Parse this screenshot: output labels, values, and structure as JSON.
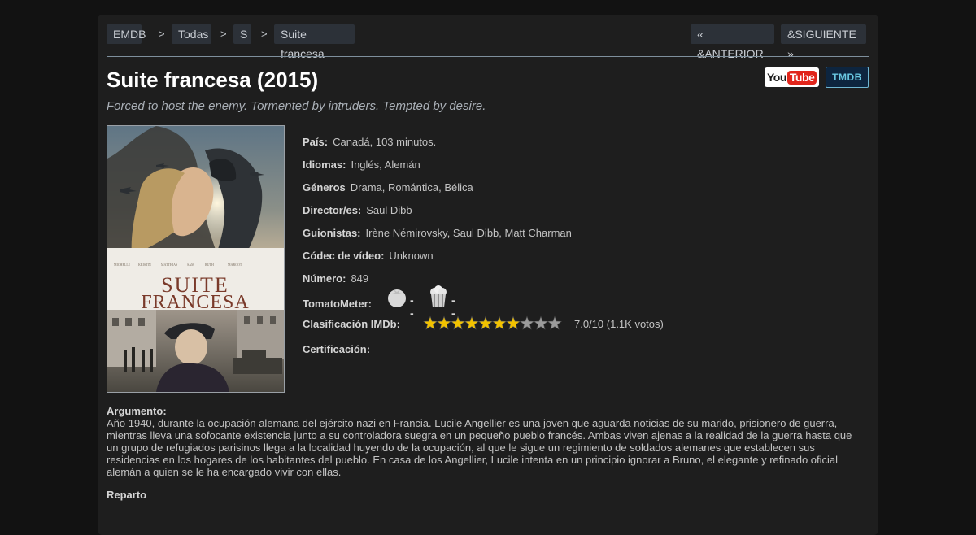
{
  "breadcrumb": {
    "items": [
      "EMDB",
      "Todas",
      "S",
      "Suite francesa"
    ],
    "separator": ">"
  },
  "nav": {
    "prev_label": "« &ANTERIOR",
    "next_label": "&SIGUIENTE »"
  },
  "logos": {
    "youtube_you": "You",
    "youtube_tube": "Tube",
    "tmdb": "TMDB"
  },
  "movie": {
    "title": "Suite francesa (2015)",
    "tagline": "Forced to host the enemy. Tormented by intruders. Tempted by desire.",
    "poster": {
      "title_line1": "SUITE",
      "title_line2": "FRANCESA"
    }
  },
  "details": {
    "pais_label": "País:",
    "pais_value": "Canadá, 103 minutos.",
    "idiomas_label": "Idiomas:",
    "idiomas_value": "Inglés, Alemán",
    "generos_label": "Géneros",
    "generos_value": "Drama, Romántica, Bélica",
    "director_label": "Director/es:",
    "director_value": "Saul Dibb",
    "guionistas_label": "Guionistas:",
    "guionistas_value": "Irène Némirovsky, Saul Dibb, Matt Charman",
    "codec_label": "Códec de vídeo:",
    "codec_value": "Unknown",
    "numero_label": "Número:",
    "numero_value": "849",
    "tomato_label": "TomatoMeter:",
    "tomato_critics": "--",
    "tomato_audience": "--",
    "imdb_label": "Clasificación IMDb:",
    "imdb_rating": 7.0,
    "imdb_max_stars": 10,
    "imdb_value": "7.0/10 (1.1K votos)",
    "cert_label": "Certificación:"
  },
  "plot": {
    "heading": "Argumento:",
    "text": "Año 1940, durante la ocupación alemana del ejército nazi en Francia. Lucile Angellier es una joven que aguarda noticias de su marido, prisionero de guerra, mientras lleva una sofocante existencia junto a su controladora suegra en un pequeño pueblo francés. Ambas viven ajenas a la realidad de la guerra hasta que un grupo de refugiados parisinos llega a la localidad huyendo de la ocupación, al que le sigue un regimiento de soldados alemanes que establecen sus residencias en los hogares de los habitantes del pueblo. En casa de los Angellier, Lucile intenta en un principio ignorar a Bruno, el elegante y refinado oficial alemán a quien se le ha encargado vivir con ellas."
  },
  "cast": {
    "heading": "Reparto"
  },
  "colors": {
    "page_bg": "#121212",
    "panel_bg": "#1e1e1e",
    "crumb_bg": "#2c3138",
    "star_on": "#f2c200",
    "star_off": "#9b9b9b",
    "youtube_red": "#e1251b",
    "tmdb_bg": "#0d253f",
    "tmdb_text": "#69c7e1"
  }
}
